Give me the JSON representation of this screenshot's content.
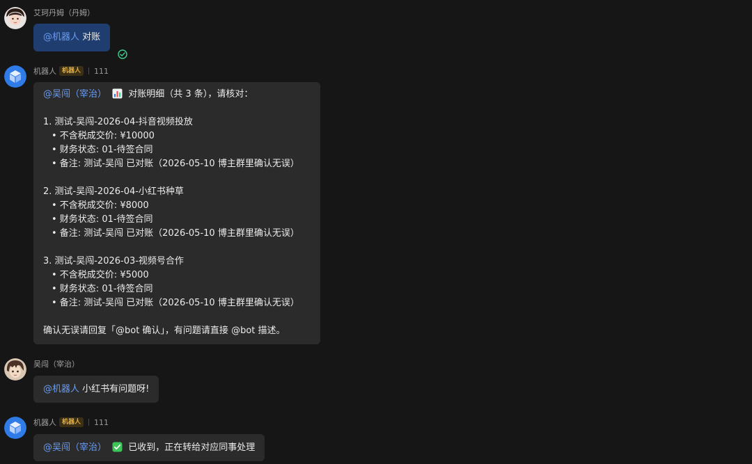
{
  "messages": [
    {
      "sender": "艾珂丹姆（丹姆）",
      "mention": "@机器人",
      "text": "对账"
    },
    {
      "sender": "机器人",
      "tag": "机器人",
      "ext": "111",
      "mention": "@吴闯（宰治）",
      "header": "对账明细（共 3 条），请核对：",
      "items": [
        {
          "title": "1. 测试-吴闯-2026-04-抖音视频投放",
          "price": "• 不含税成交价: ¥10000",
          "status": "• 财务状态: 01-待签合同",
          "note": "• 备注: 测试-吴闯 已对账（2026-05-10 博主群里确认无误）"
        },
        {
          "title": "2. 测试-吴闯-2026-04-小红书种草",
          "price": "• 不含税成交价: ¥8000",
          "status": "• 财务状态: 01-待签合同",
          "note": "• 备注: 测试-吴闯 已对账（2026-05-10 博主群里确认无误）"
        },
        {
          "title": "3. 测试-吴闯-2026-03-视频号合作",
          "price": "• 不含税成交价: ¥5000",
          "status": "• 财务状态: 01-待签合同",
          "note": "• 备注: 测试-吴闯 已对账（2026-05-10 博主群里确认无误）"
        }
      ],
      "footer": "确认无误请回复「@bot 确认」，有问题请直接 @bot 描述。"
    },
    {
      "sender": "吴闯（宰治）",
      "mention": "@机器人",
      "text": "小红书有问题呀!"
    },
    {
      "sender": "机器人",
      "tag": "机器人",
      "ext": "111",
      "mention": "@吴闯（宰治）",
      "text": "已收到，正在转给对应同事处理"
    }
  ],
  "icons": {
    "read_receipt": "check-circle-icon",
    "chart_emoji": "bar-chart-icon",
    "check_emoji": "green-check-icon",
    "bot_avatar": "cube-icon"
  },
  "colors": {
    "background": "#161616",
    "bubble": "#2b2b2b",
    "self_bubble": "#1f3d6e",
    "mention": "#6a9cf2",
    "bot_tag": "#e8b03a",
    "bot_avatar": "#2f7ce8",
    "read_check": "#3ecf8e"
  }
}
